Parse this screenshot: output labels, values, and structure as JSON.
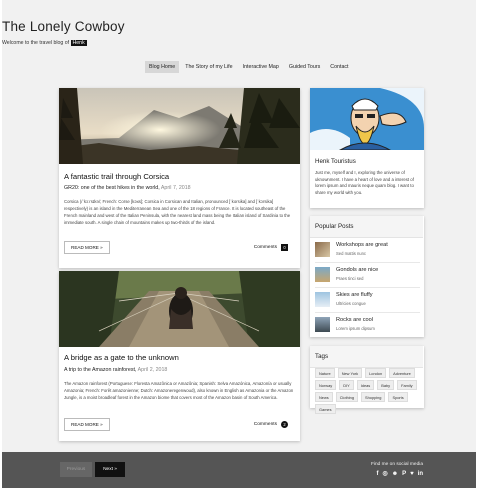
{
  "site": {
    "title": "The Lonely Cowboy",
    "tagline": "Welcome to the travel blog of",
    "tagline_name": "Henk"
  },
  "nav": {
    "items": [
      {
        "label": "Blog Home",
        "active": true
      },
      {
        "label": "The Story of my Life"
      },
      {
        "label": "Interactive Map"
      },
      {
        "label": "Guided Tours"
      },
      {
        "label": "Contact"
      }
    ]
  },
  "posts": [
    {
      "title": "A fantastic trail through Corsica",
      "subtitle": "GR20: one of the best hikes in the world,",
      "date": "April 7, 2018",
      "body": "Corsica (/ˈkɔːrsɪkə/; French: Corse [kɔʁs]; Corsica in Corsican and Italian, pronounced [ˈkorsika] and [ˈkɔrsika] respectively) is an island in the Mediterranean Sea and one of the 18 regions of France. It is located southeast of the French mainland and west of the Italian Peninsula, with the nearest land mass being the Italian island of Sardinia to the immediate south. A single chain of mountains makes up two-thirds of the island.",
      "read_more": "READ MORE »",
      "comments_label": "Comments",
      "comments_count": "0"
    },
    {
      "title": "A bridge as a gate to the unknown",
      "subtitle": "A trip to the Amazon rainforest,",
      "date": "April 2, 2018",
      "body": "The Amazon rainforest (Portuguese: Floresta Amazônica or Amazônia; Spanish: Selva Amazónica, Amazonía or usually Amazonia; French: Forêt amazonienne; Dutch: Amazoneregenwoud), also known in English as Amazonia or the Amazon Jungle, is a moist broadleaf forest in the Amazon biome that covers most of the Amazon basin of South America.",
      "read_more": "READ MORE »",
      "comments_label": "Comments",
      "comments_count": "2"
    }
  ],
  "about": {
    "name": "Henk Touristus",
    "text": "Just me, myself and I, exploring the universe of uknownment. I have a heart of love and a interest of lorem ipsum and mauris neque quam blog. I want to share my world with you."
  },
  "popular": {
    "title": "Popular Posts",
    "items": [
      {
        "title": "Workshops are great",
        "sub": "Sed mattis nunc"
      },
      {
        "title": "Gondols are nice",
        "sub": "Praes tinci sed"
      },
      {
        "title": "Skies are fluffy",
        "sub": "Ultricies congue"
      },
      {
        "title": "Rocks are cool",
        "sub": "Lorem ipsum dipsum"
      }
    ]
  },
  "tags": {
    "title": "Tags",
    "items": [
      "Nature",
      "New York",
      "London",
      "Adventure",
      "Norway",
      "DIY",
      "Ideas",
      "Baby",
      "Family",
      "News",
      "Clothing",
      "Shopping",
      "Sports",
      "Games"
    ]
  },
  "footer": {
    "previous": "Previous",
    "next": "Next »",
    "social_title": "Find me on social media",
    "social_icons": [
      "facebook-icon",
      "instagram-icon",
      "snapchat-icon",
      "pinterest-icon",
      "twitter-icon",
      "linkedin-icon"
    ]
  },
  "colors": {
    "accent_dark": "#111111",
    "background": "#f1f1f1",
    "footer": "#555555",
    "nav_active": "#d7d7d7"
  }
}
